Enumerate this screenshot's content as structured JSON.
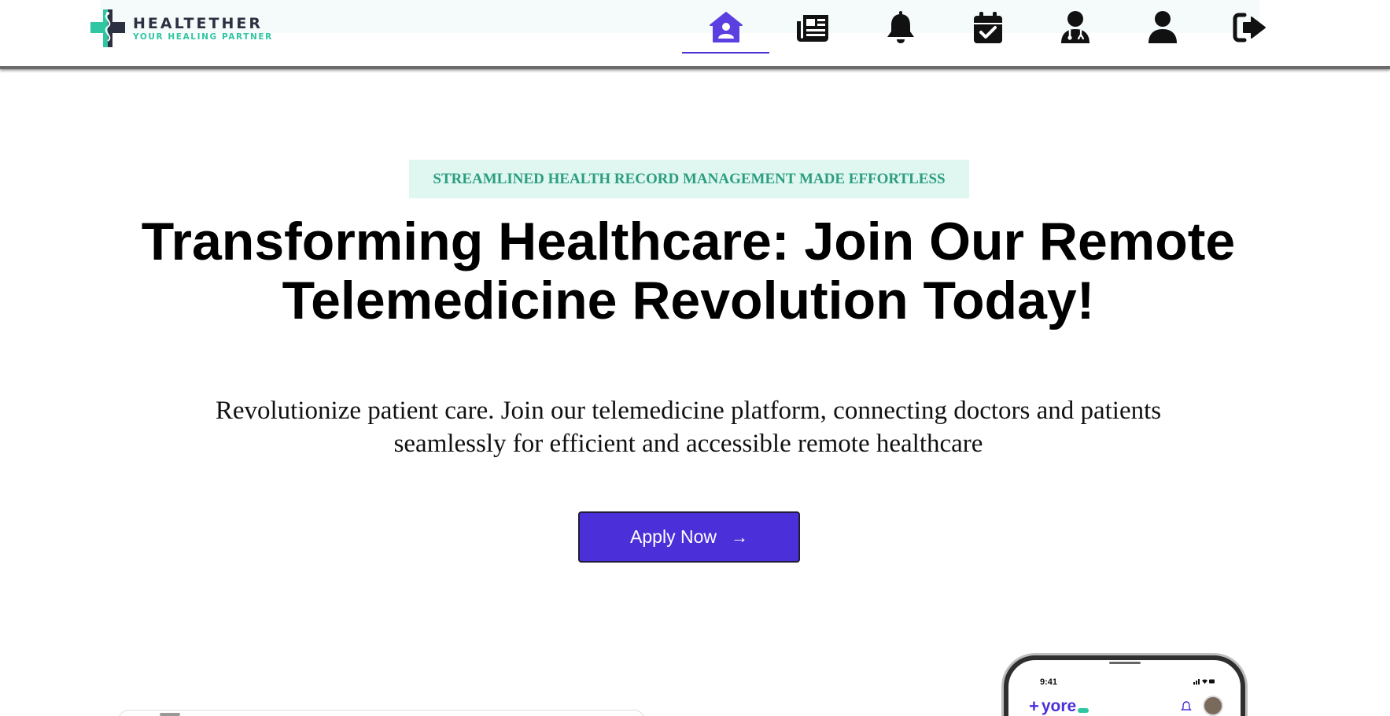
{
  "header": {
    "brand": "HEALTETHER",
    "tagline": "YOUR HEALING PARTNER",
    "nav": [
      {
        "icon": "home-icon",
        "active": true
      },
      {
        "icon": "newspaper-icon",
        "active": false
      },
      {
        "icon": "bell-icon",
        "active": false
      },
      {
        "icon": "calendar-check-icon",
        "active": false
      },
      {
        "icon": "doctor-icon",
        "active": false
      },
      {
        "icon": "user-icon",
        "active": false
      },
      {
        "icon": "logout-icon",
        "active": false
      }
    ]
  },
  "hero": {
    "badge": "STREAMLINED HEALTH RECORD MANAGEMENT MADE EFFORTLESS",
    "title_line1": "Transforming Healthcare: Join Our Remote",
    "title_line2": "Telemedicine Revolution Today!",
    "subtitle_line1": "Revolutionize patient care. Join our telemedicine platform, connecting doctors and patients",
    "subtitle_line2": "seamlessly for efficient and accessible remote healthcare",
    "cta_label": "Apply Now",
    "cta_arrow": "→"
  },
  "phone_preview": {
    "time": "9:41",
    "app_name": "yore"
  },
  "colors": {
    "accent": "#4b2fd9",
    "teal": "#2fc6a1",
    "badge_bg": "#dff7f0",
    "badge_text": "#2c9d80"
  }
}
